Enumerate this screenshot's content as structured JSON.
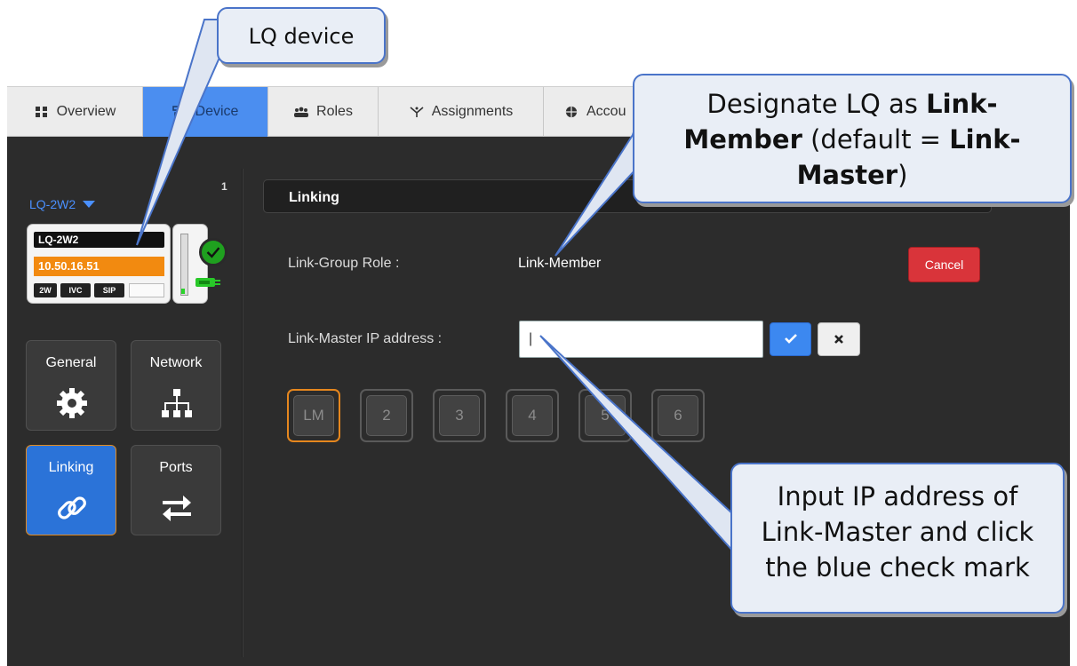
{
  "nav": {
    "tabs": [
      {
        "label": "Overview",
        "icon": "grid-icon",
        "active": false
      },
      {
        "label": "Device",
        "icon": "device-icon",
        "active": true
      },
      {
        "label": "Roles",
        "icon": "users-icon",
        "active": false
      },
      {
        "label": "Assignments",
        "icon": "assignments-icon",
        "active": false
      },
      {
        "label": "Accou",
        "icon": "globe-icon",
        "active": false
      }
    ]
  },
  "sidebar": {
    "device_select": "LQ-2W2",
    "device_count": "1",
    "device_card": {
      "name": "LQ-2W2",
      "ip": "10.50.16.51",
      "tags": [
        "2W",
        "IVC",
        "SIP"
      ],
      "status": "check-icon"
    },
    "tiles": [
      {
        "label": "General",
        "icon": "gear-icon",
        "active": false
      },
      {
        "label": "Network",
        "icon": "network-icon",
        "active": false
      },
      {
        "label": "Linking",
        "icon": "link-icon",
        "active": true
      },
      {
        "label": "Ports",
        "icon": "arrows-icon",
        "active": false
      }
    ]
  },
  "panel": {
    "title": "Linking",
    "role_label": "Link-Group Role :",
    "role_value": "Link-Member",
    "cancel_label": "Cancel",
    "ip_label": "Link-Master IP address :",
    "ip_value": "|",
    "slots": [
      "LM",
      "2",
      "3",
      "4",
      "5",
      "6"
    ]
  },
  "callouts": {
    "device": "LQ device",
    "member": {
      "t1": "Designate LQ as ",
      "b1": "Link-",
      "b2": "Member",
      "t2": " (default = ",
      "b3": "Link-",
      "b4": "Master",
      "t3": ")"
    },
    "input": {
      "l1": "Input IP address of",
      "l2": "Link-Master and click",
      "l3": "the blue check mark"
    }
  },
  "colors": {
    "accent_blue": "#4b8ef0",
    "link_blue": "#4a90ff",
    "orange": "#f28a10",
    "cancel_red": "#d9343a",
    "ok_green": "#1fa01f",
    "panel_dark": "#2c2c2c"
  }
}
